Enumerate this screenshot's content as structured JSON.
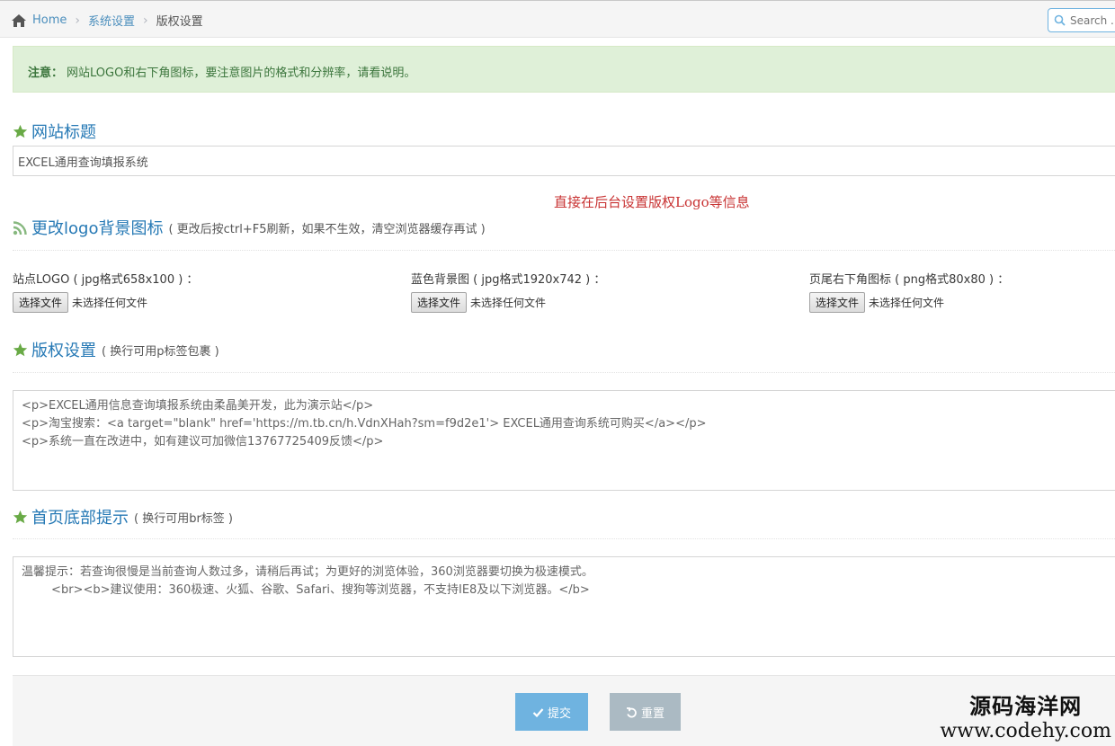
{
  "breadcrumb": {
    "home": "Home",
    "level1": "系统设置",
    "current": "版权设置",
    "separator": "›"
  },
  "search": {
    "placeholder": "Search ..."
  },
  "alert": {
    "label": "注意：",
    "text": "网站LOGO和右下角图标，要注意图片的格式和分辨率，请看说明。"
  },
  "site_title": {
    "heading": "网站标题",
    "value": "EXCEL通用查询填报系统"
  },
  "red_note": "直接在后台设置版权Logo等信息",
  "logo_section": {
    "heading": "更改logo背景图标",
    "hint": "( 更改后按ctrl+F5刷新，如果不生效，清空浏览器缓存再试 )"
  },
  "uploads": [
    {
      "label": "站点LOGO ( jpg格式658x100 ) ：",
      "button": "选择文件",
      "status": "未选择任何文件"
    },
    {
      "label": "蓝色背景图 ( jpg格式1920x742 ) ：",
      "button": "选择文件",
      "status": "未选择任何文件"
    },
    {
      "label": "页尾右下角图标 ( png格式80x80 ) ：",
      "button": "选择文件",
      "status": "未选择任何文件"
    }
  ],
  "copyright": {
    "heading": "版权设置",
    "hint": "( 换行可用p标签包裹 )",
    "content": "<p>EXCEL通用信息查询填报系统由柔晶美开发，此为演示站</p>\n<p>淘宝搜索：<a target=\"blank\" href='https://m.tb.cn/h.VdnXHah?sm=f9d2e1'> EXCEL通用查询系统可购买</a></p>\n<p>系统一直在改进中，如有建议可加微信13767725409反馈</p>"
  },
  "footer_tip": {
    "heading": "首页底部提示",
    "hint": "( 换行可用br标签 )",
    "content": "温馨提示：若查询很慢是当前查询人数过多，请稍后再试；为更好的浏览体验，360浏览器要切换为极速模式。\n        <br><b>建议使用：360极速、火狐、谷歌、Safari、搜狗等浏览器，不支持IE8及以下浏览器。</b>"
  },
  "actions": {
    "submit": "提交",
    "reset": "重置"
  },
  "watermark": {
    "line1": "源码海洋网",
    "line2": "www.codehy.com"
  },
  "colors": {
    "link": "#4c8fbd",
    "heading": "#2679b5",
    "star": "#69aa46",
    "rss": "#87b87f",
    "submit": "#6fb3e0",
    "reset": "#abbac3",
    "alert_bg": "#dff0d8",
    "note": "#c83232"
  }
}
